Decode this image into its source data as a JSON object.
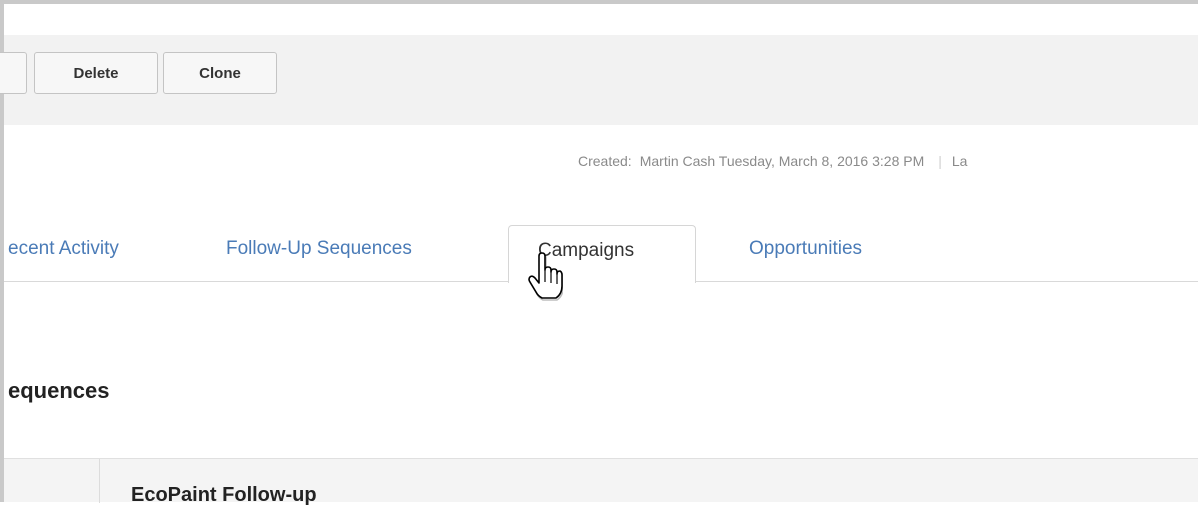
{
  "toolbar": {
    "delete_label": "Delete",
    "clone_label": "Clone"
  },
  "meta": {
    "created_label": "Created:",
    "created_value": "Martin Cash Tuesday, March 8, 2016 3:28 PM",
    "separator": "|",
    "trailing": "La"
  },
  "tabs": {
    "recent_activity": "ecent Activity",
    "follow_up": "Follow-Up Sequences",
    "campaigns": "Campaigns",
    "opportunities": "Opportunities"
  },
  "section": {
    "title": "equences"
  },
  "table": {
    "first_row_name": "EcoPaint Follow-up"
  },
  "icons": {
    "cursor": "hand-pointer-icon"
  },
  "colors": {
    "tab_link": "#4a7bb7",
    "toolbar_bg": "#f2f2f2"
  }
}
